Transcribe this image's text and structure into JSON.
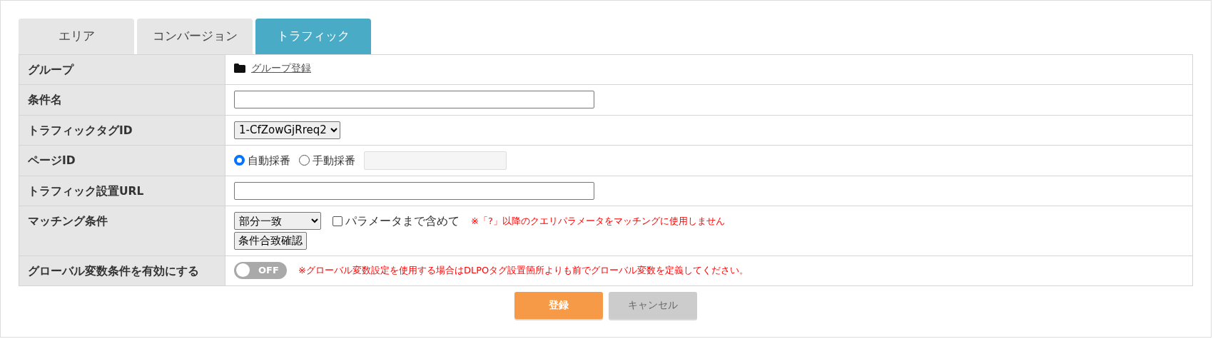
{
  "tabs": [
    {
      "label": "エリア",
      "selected": false
    },
    {
      "label": "コンバージョン",
      "selected": false
    },
    {
      "label": "トラフィック",
      "selected": true
    }
  ],
  "rows": [
    {
      "kind": "link",
      "label": "グループ",
      "link": "グループ登録"
    },
    {
      "kind": "text",
      "label": "条件名"
    },
    {
      "kind": "select",
      "label": "トラフィックタグID",
      "value": "1-CfZowGjRreq2"
    },
    {
      "kind": "radio",
      "label": "ページID",
      "options": [
        {
          "label": "自動採番",
          "selected": true
        },
        {
          "label": "手動採番",
          "selected": false
        }
      ],
      "field_disabled": true
    },
    {
      "kind": "text",
      "label": "トラフィック設置URL"
    },
    {
      "kind": "matching",
      "label": "マッチング条件",
      "value": "部分一致",
      "checkbox": {
        "label": "パラメータまで含めて",
        "checked": false
      },
      "note": "※「?」以降のクエリパラメータをマッチングに使用しません",
      "button": "条件合致確認"
    },
    {
      "kind": "toggle",
      "label": "グローバル変数条件を有効にする",
      "toggle": {
        "on": false,
        "label": "OFF"
      },
      "note": "※グローバル変数設定を使用する場合はDLPOタグ設置箇所よりも前でグローバル変数を定義してください。"
    }
  ],
  "buttons": [
    {
      "label": "登録",
      "kind": "primary"
    },
    {
      "label": "キャンセル",
      "kind": "secondary"
    }
  ]
}
